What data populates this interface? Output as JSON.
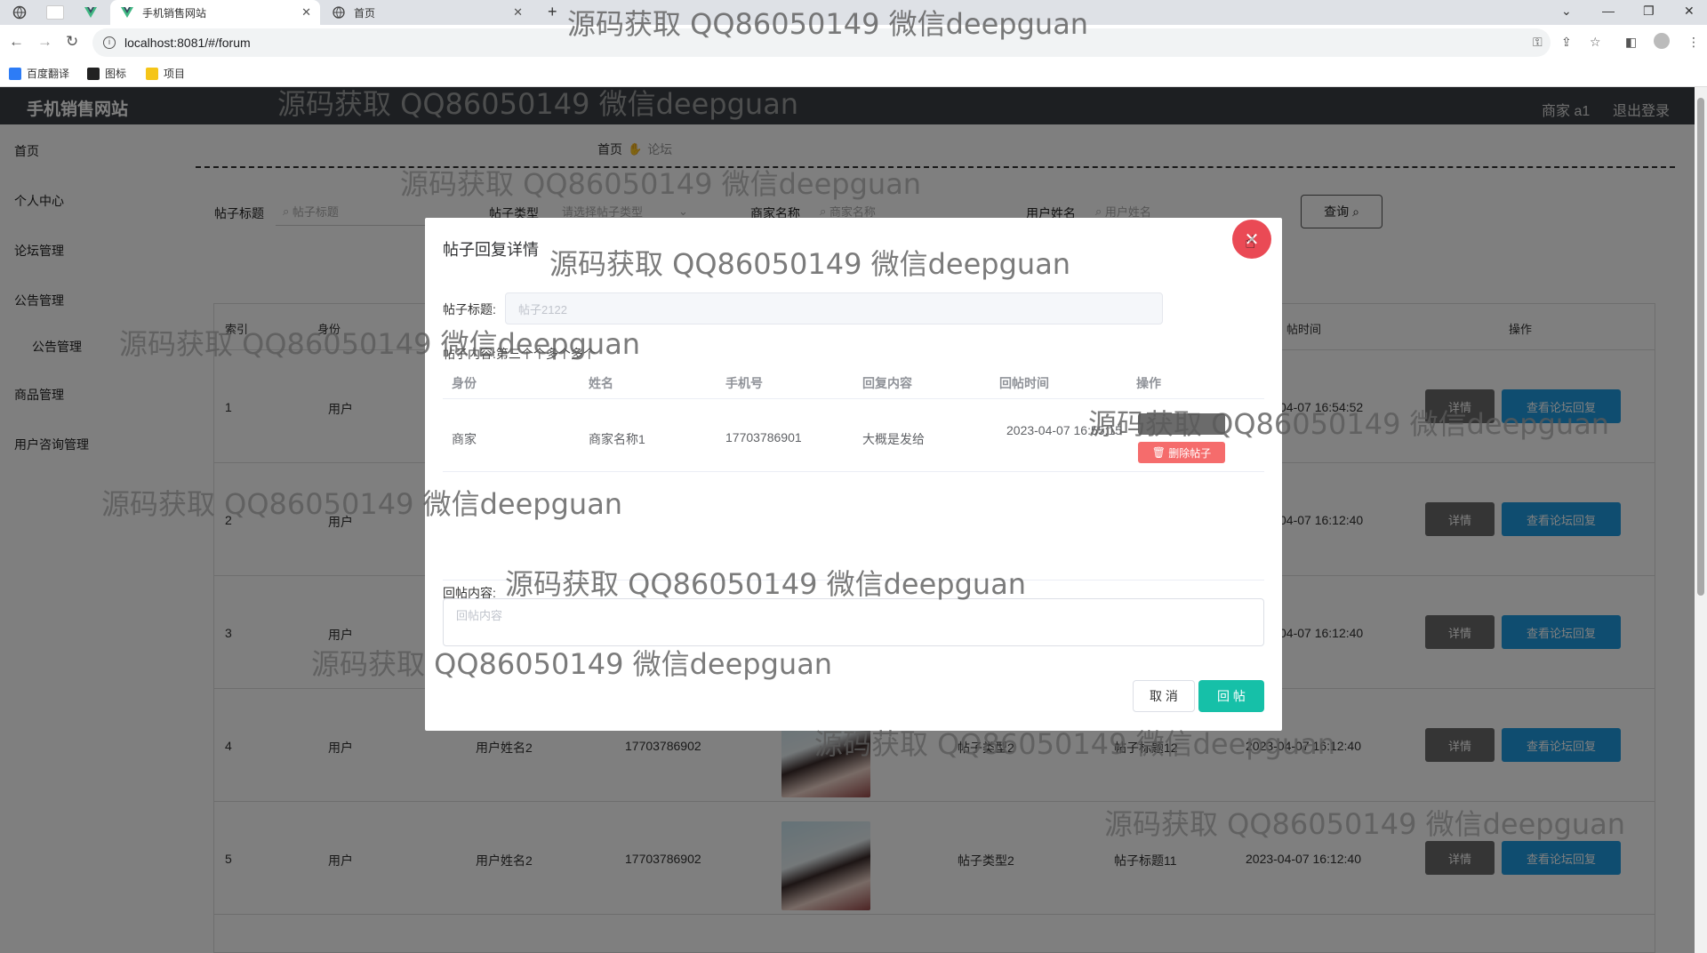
{
  "browser": {
    "tabs": [
      {
        "title": "手机销售网站",
        "active": true
      },
      {
        "title": "首页",
        "active": false
      }
    ],
    "url": "localhost:8081/#/forum",
    "bookmarks": [
      "百度翻译",
      "图标",
      "项目"
    ]
  },
  "header": {
    "logo": "手机销售网站",
    "user": "商家 a1",
    "logout": "退出登录"
  },
  "sidebar": {
    "items": [
      "首页",
      "个人中心",
      "论坛管理",
      "公告管理",
      "公告管理",
      "商品管理",
      "用户咨询管理"
    ]
  },
  "breadcrumb": {
    "home": "首页",
    "current": "论坛"
  },
  "search": {
    "title_label": "帖子标题",
    "title_placeholder": "帖子标题",
    "type_label": "帖子类型",
    "type_placeholder": "请选择帖子类型",
    "merchant_label": "商家名称",
    "merchant_placeholder": "商家名称",
    "user_label": "用户姓名",
    "user_placeholder": "用户姓名",
    "query_button": "查询"
  },
  "table": {
    "headers": {
      "index": "索引",
      "identity": "身份",
      "time": "帖时间",
      "ops": "操作"
    },
    "rows": [
      {
        "index": "1",
        "identity": "用户",
        "name": "",
        "phone": "",
        "type": "",
        "title": "",
        "time": "04-07 16:54:52"
      },
      {
        "index": "2",
        "identity": "用户",
        "name": "",
        "phone": "",
        "type": "",
        "title": "",
        "time": "04-07 16:12:40"
      },
      {
        "index": "3",
        "identity": "用户",
        "name": "",
        "phone": "",
        "type": "",
        "title": "",
        "time": "04-07 16:12:40"
      },
      {
        "index": "4",
        "identity": "用户",
        "name": "用户姓名2",
        "phone": "17703786902",
        "type": "帖子类型2",
        "title": "帖子标题12",
        "time": "2023-04-07 16:12:40"
      },
      {
        "index": "5",
        "identity": "用户",
        "name": "用户姓名2",
        "phone": "17703786902",
        "type": "帖子类型2",
        "title": "帖子标题11",
        "time": "2023-04-07 16:12:40"
      }
    ],
    "detail_button": "详情",
    "reply_button": "查看论坛回复"
  },
  "dialog": {
    "title": "帖子回复详情",
    "post_title_label": "帖子标题:",
    "post_title_value": "帖子2122",
    "content_label": "帖子内容:",
    "content_value": "第三个个多个多个",
    "columns": [
      "身份",
      "姓名",
      "手机号",
      "回复内容",
      "回帖时间",
      "操作"
    ],
    "reply": {
      "identity": "商家",
      "name": "商家名称1",
      "phone": "17703786901",
      "content": "大概是发给",
      "time": "2023-04-07 16:55:15",
      "delete_label": "删除帖子"
    },
    "reply_input_label": "回帖内容:",
    "reply_input_placeholder": "回帖内容",
    "cancel_button": "取 消",
    "submit_button": "回 帖"
  },
  "watermark": "源码获取 QQ86050149 微信deepguan"
}
